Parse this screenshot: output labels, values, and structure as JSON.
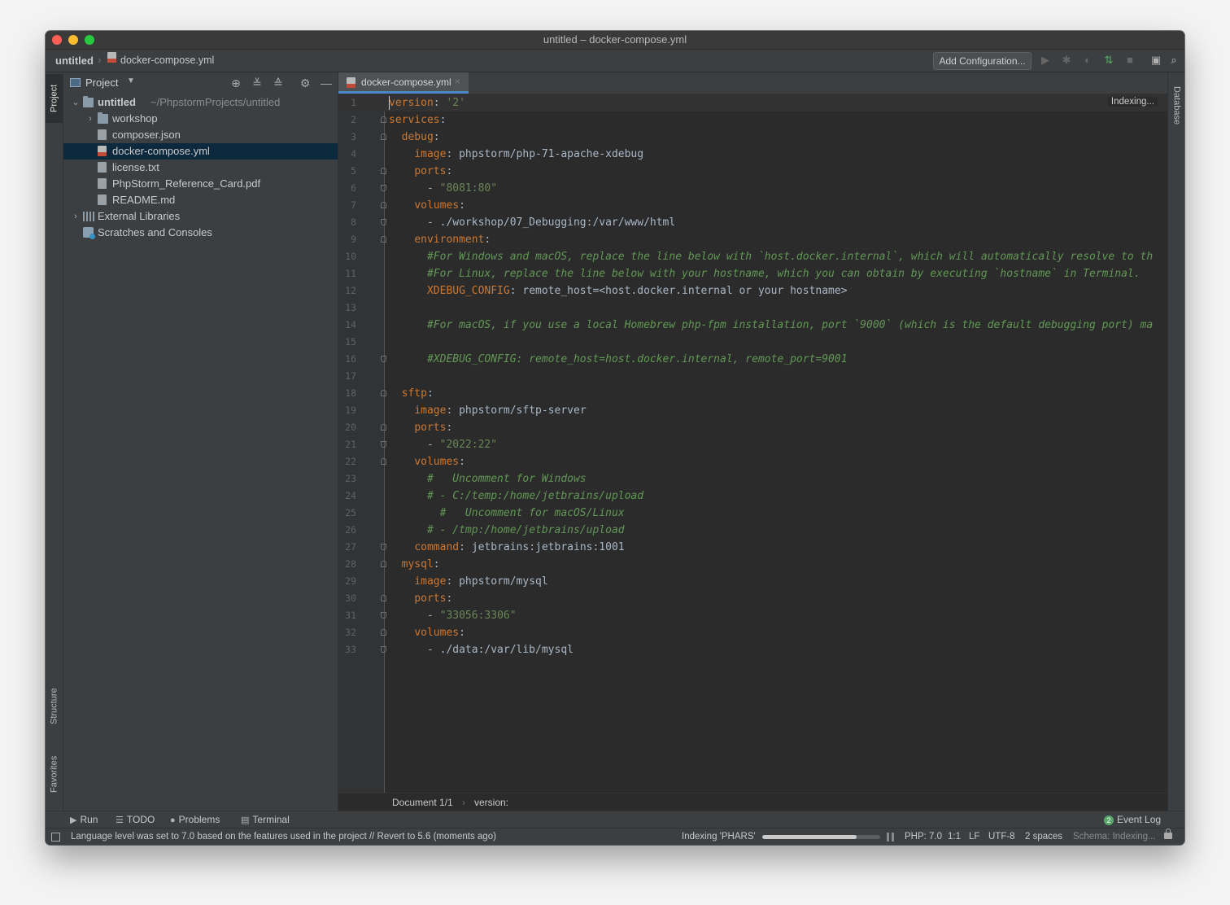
{
  "window": {
    "title": "untitled – docker-compose.yml"
  },
  "navbar": {
    "project": "untitled",
    "file": "docker-compose.yml",
    "add_configuration": "Add Configuration..."
  },
  "left_stripe": {
    "project_tab": "Project",
    "structure_tab": "Structure",
    "favorites_tab": "Favorites"
  },
  "right_stripe": {
    "database_tab": "Database"
  },
  "project_panel": {
    "title": "Project",
    "tree": [
      {
        "label": "untitled",
        "path": "~/PhpstormProjects/untitled",
        "type": "folder",
        "expanded": true,
        "level": 0
      },
      {
        "label": "workshop",
        "type": "folder",
        "expanded": false,
        "level": 1
      },
      {
        "label": "composer.json",
        "type": "json-file",
        "level": 1
      },
      {
        "label": "docker-compose.yml",
        "type": "yml-file",
        "level": 1,
        "selected": true
      },
      {
        "label": "license.txt",
        "type": "text-file",
        "level": 1
      },
      {
        "label": "PhpStorm_Reference_Card.pdf",
        "type": "pdf-file",
        "level": 1
      },
      {
        "label": "README.md",
        "type": "md-file",
        "level": 1
      },
      {
        "label": "External Libraries",
        "type": "library",
        "expanded": false,
        "level": 0
      },
      {
        "label": "Scratches and Consoles",
        "type": "scratches",
        "level": 0
      }
    ]
  },
  "editor": {
    "tab_label": "docker-compose.yml",
    "indexing_hint": "Indexing...",
    "lines": [
      [
        [
          "key",
          "version"
        ],
        [
          "plain",
          ": "
        ],
        [
          "str",
          "'2'"
        ]
      ],
      [
        [
          "key",
          "services"
        ],
        [
          "plain",
          ":"
        ]
      ],
      [
        [
          "plain",
          "  "
        ],
        [
          "key",
          "debug"
        ],
        [
          "plain",
          ":"
        ]
      ],
      [
        [
          "plain",
          "    "
        ],
        [
          "key",
          "image"
        ],
        [
          "plain",
          ": phpstorm/php-71-apache-xdebug"
        ]
      ],
      [
        [
          "plain",
          "    "
        ],
        [
          "key",
          "ports"
        ],
        [
          "plain",
          ":"
        ]
      ],
      [
        [
          "plain",
          "      - "
        ],
        [
          "str",
          "\"8081:80\""
        ]
      ],
      [
        [
          "plain",
          "    "
        ],
        [
          "key",
          "volumes"
        ],
        [
          "plain",
          ":"
        ]
      ],
      [
        [
          "plain",
          "      - ./workshop/07_Debugging:/var/www/html"
        ]
      ],
      [
        [
          "plain",
          "    "
        ],
        [
          "key",
          "environment"
        ],
        [
          "plain",
          ":"
        ]
      ],
      [
        [
          "plain",
          "      "
        ],
        [
          "cmt",
          "#For Windows and macOS, replace the line below with `host.docker.internal`, which will automatically resolve to th"
        ]
      ],
      [
        [
          "plain",
          "      "
        ],
        [
          "cmt",
          "#For Linux, replace the line below with your hostname, which you can obtain by executing `hostname` in Terminal."
        ]
      ],
      [
        [
          "plain",
          "      "
        ],
        [
          "key",
          "XDEBUG_CONFIG"
        ],
        [
          "plain",
          ": remote_host=<host.docker.internal or your hostname>"
        ]
      ],
      [
        [
          "plain",
          ""
        ]
      ],
      [
        [
          "plain",
          "      "
        ],
        [
          "cmt",
          "#For macOS, if you use a local Homebrew php-fpm installation, port `9000` (which is the default debugging port) ma"
        ]
      ],
      [
        [
          "plain",
          ""
        ]
      ],
      [
        [
          "plain",
          "      "
        ],
        [
          "cmt",
          "#XDEBUG_CONFIG: remote_host=host.docker.internal, remote_port=9001"
        ]
      ],
      [
        [
          "plain",
          ""
        ]
      ],
      [
        [
          "plain",
          "  "
        ],
        [
          "key",
          "sftp"
        ],
        [
          "plain",
          ":"
        ]
      ],
      [
        [
          "plain",
          "    "
        ],
        [
          "key",
          "image"
        ],
        [
          "plain",
          ": phpstorm/sftp-server"
        ]
      ],
      [
        [
          "plain",
          "    "
        ],
        [
          "key",
          "ports"
        ],
        [
          "plain",
          ":"
        ]
      ],
      [
        [
          "plain",
          "      - "
        ],
        [
          "str",
          "\"2022:22\""
        ]
      ],
      [
        [
          "plain",
          "    "
        ],
        [
          "key",
          "volumes"
        ],
        [
          "plain",
          ":"
        ]
      ],
      [
        [
          "plain",
          "      "
        ],
        [
          "cmt",
          "#   Uncomment for Windows"
        ]
      ],
      [
        [
          "plain",
          "      "
        ],
        [
          "cmt",
          "# - C:/temp:/home/jetbrains/upload"
        ]
      ],
      [
        [
          "plain",
          "        "
        ],
        [
          "cmt",
          "#   Uncomment for macOS/Linux"
        ]
      ],
      [
        [
          "plain",
          "      "
        ],
        [
          "cmt",
          "# - /tmp:/home/jetbrains/upload"
        ]
      ],
      [
        [
          "plain",
          "    "
        ],
        [
          "key",
          "command"
        ],
        [
          "plain",
          ": jetbrains:jetbrains:1001"
        ]
      ],
      [
        [
          "plain",
          "  "
        ],
        [
          "key",
          "mysql"
        ],
        [
          "plain",
          ":"
        ]
      ],
      [
        [
          "plain",
          "    "
        ],
        [
          "key",
          "image"
        ],
        [
          "plain",
          ": phpstorm/mysql"
        ]
      ],
      [
        [
          "plain",
          "    "
        ],
        [
          "key",
          "ports"
        ],
        [
          "plain",
          ":"
        ]
      ],
      [
        [
          "plain",
          "      - "
        ],
        [
          "str",
          "\"33056:3306\""
        ]
      ],
      [
        [
          "plain",
          "    "
        ],
        [
          "key",
          "volumes"
        ],
        [
          "plain",
          ":"
        ]
      ],
      [
        [
          "plain",
          "      - ./data:/var/lib/mysql"
        ]
      ]
    ],
    "fold_markers": {
      "2": "start",
      "3": "start",
      "5": "start",
      "6": "end",
      "7": "start",
      "8": "end",
      "9": "start",
      "16": "end",
      "18": "start",
      "20": "start",
      "21": "end",
      "22": "start",
      "27": "end",
      "28": "start",
      "30": "start",
      "31": "end",
      "32": "start",
      "33": "end"
    }
  },
  "breadcrumb": {
    "document": "Document 1/1",
    "node": "version:"
  },
  "tool_windows": {
    "run": "Run",
    "todo": "TODO",
    "problems": "Problems",
    "terminal": "Terminal",
    "event_log": "Event Log",
    "event_count": "2"
  },
  "status_bar": {
    "message": "Language level was set to 7.0 based on the features used in the project // Revert to 5.6 (moments ago)",
    "indexing_label": "Indexing 'PHARS'",
    "indexing_progress": 0.8,
    "php_version": "PHP: 7.0",
    "position": "1:1",
    "line_ending": "LF",
    "encoding": "UTF-8",
    "indent": "2 spaces",
    "schema": "Schema: Indexing..."
  },
  "colors": {
    "keyword": "#cc7832",
    "string": "#6a8759",
    "comment": "#629755",
    "text": "#a9b7c6",
    "selection": "#0d293e",
    "editor_bg": "#2b2b2b",
    "panel_bg": "#3c3f41"
  }
}
